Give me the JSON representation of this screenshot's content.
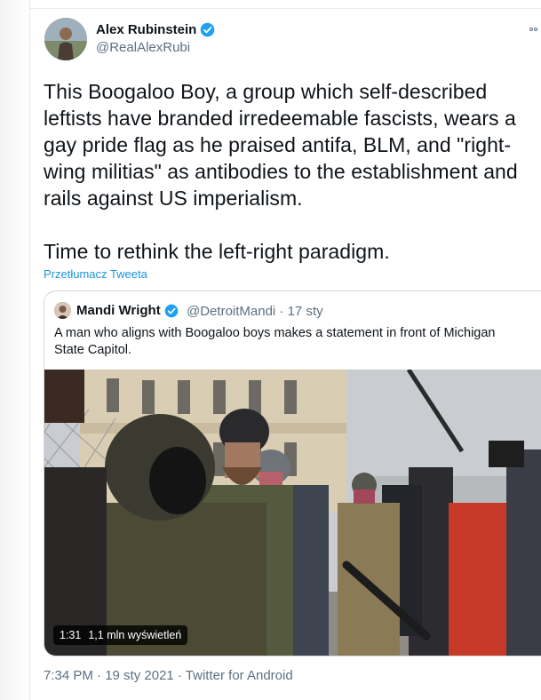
{
  "tweet": {
    "author_name": "Alex Rubinstein",
    "author_handle": "@RealAlexRubi",
    "text": "This Boogaloo Boy, a group which self-described leftists have branded irredeemable fascists, wears a gay pride flag as he praised antifa, BLM, and \"right-wing militias\" as antibodies to the establishment and rails against US imperialism.\n\nTime to rethink the left-right paradigm.",
    "translate_label": "Przetłumacz Tweeta",
    "timestamp": "7:34 PM · 19 sty 2021 · Twitter for Android"
  },
  "quoted": {
    "author_name": "Mandi Wright",
    "author_meta": "@DetroitMandi · 17 sty",
    "text": "A man who aligns with Boogaloo boys makes a statement in front of Michigan State Capitol.",
    "video_duration": "1:31",
    "video_views": "1,1 mln wyświetleń"
  },
  "colors": {
    "verified": "#1da1f2",
    "link": "#1b95e0",
    "secondary_text": "#5b7083"
  },
  "icons": [
    "verified-badge-icon",
    "more-options-icon"
  ]
}
